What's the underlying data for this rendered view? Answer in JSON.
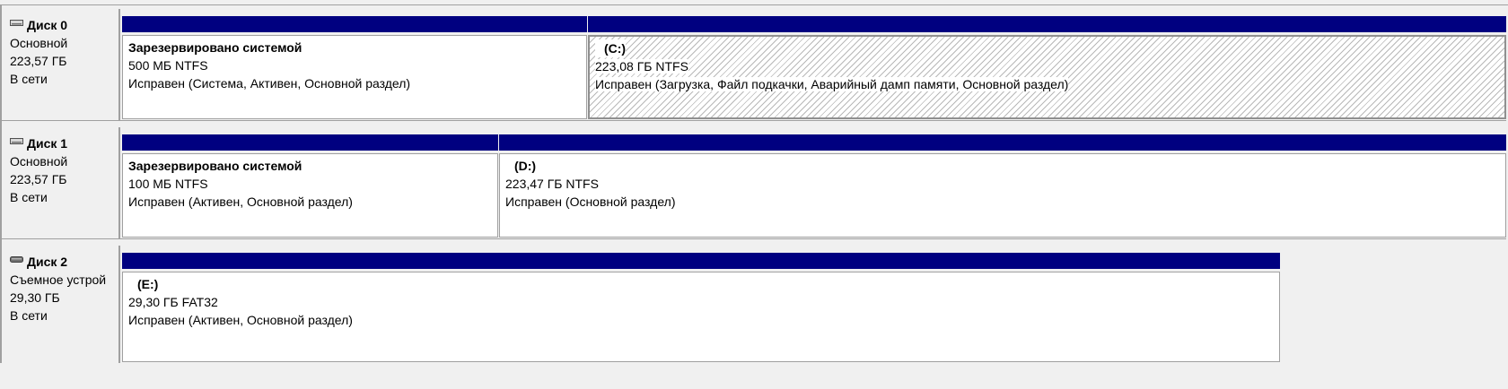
{
  "disks": [
    {
      "name": "Диск 0",
      "type": "Основной",
      "size": "223,57 ГБ",
      "status": "В сети",
      "icon": "hard-disk-icon",
      "partitions": [
        {
          "name": "Зарезервировано системой",
          "size_fs": "500 МБ NTFS",
          "health": "Исправен (Система, Активен, Основной раздел)",
          "selected": false
        },
        {
          "name": "(C:)",
          "size_fs": "223,08 ГБ NTFS",
          "health": "Исправен (Загрузка, Файл подкачки, Аварийный дамп памяти, Основной раздел)",
          "selected": true
        }
      ]
    },
    {
      "name": "Диск 1",
      "type": "Основной",
      "size": "223,57 ГБ",
      "status": "В сети",
      "icon": "hard-disk-icon",
      "partitions": [
        {
          "name": "Зарезервировано системой",
          "size_fs": "100 МБ NTFS",
          "health": "Исправен (Активен, Основной раздел)",
          "selected": false
        },
        {
          "name": "(D:)",
          "size_fs": "223,47 ГБ NTFS",
          "health": "Исправен (Основной раздел)",
          "selected": false
        }
      ]
    },
    {
      "name": "Диск 2",
      "type": "Съемное устрой",
      "size": "29,30 ГБ",
      "status": "В сети",
      "icon": "removable-disk-icon",
      "partitions": [
        {
          "name": "(E:)",
          "size_fs": "29,30 ГБ FAT32",
          "health": "Исправен (Активен, Основной раздел)",
          "selected": false
        }
      ]
    }
  ],
  "colors": {
    "primary_partition_bar": "#000080",
    "panel_background": "#f0f0f0",
    "partition_background": "#ffffff"
  }
}
